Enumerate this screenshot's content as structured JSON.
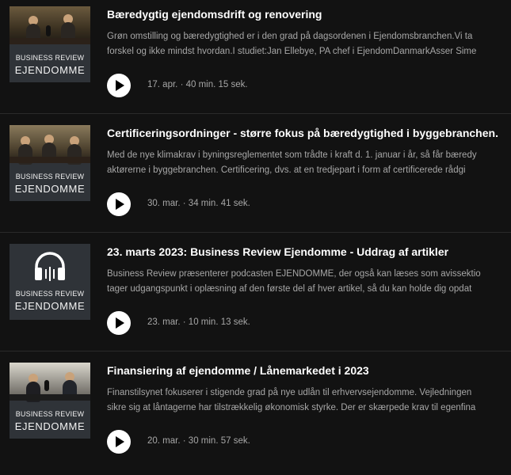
{
  "episodes": [
    {
      "title": "Bæredygtig ejendomsdrift og renovering",
      "desc_line1": "Grøn omstilling og bæredygtighed er i den grad på dagsordenen i Ejendomsbranchen.Vi ta",
      "desc_line2": "forskel og ikke mindst hvordan.I studiet:Jan Ellebye, PA chef i EjendomDanmarkAsser Sime",
      "date": "17. apr.",
      "duration": "40 min. 15 sek.",
      "brand_top": "BUSINESS REVIEW",
      "brand_bottom": "EJENDOMME"
    },
    {
      "title": "Certificeringsordninger - større fokus på bæredygtighed i byggebranchen.",
      "desc_line1": "Med de nye klimakrav i byningsreglementet som trådte i kraft d. 1. januar i år, så får bæredy",
      "desc_line2": "aktørerne i byggebranchen. Certificering, dvs. at en tredjepart i form af certificerede rådgi",
      "date": "30. mar.",
      "duration": "34 min. 41 sek.",
      "brand_top": "BUSINESS REVIEW",
      "brand_bottom": "EJENDOMME"
    },
    {
      "title": "23. marts 2023: Business Review Ejendomme - Uddrag af artikler",
      "desc_line1": "Business Review præsenterer podcasten EJENDOMME, der også kan læses som avissektio",
      "desc_line2": "tager udgangspunkt i oplæsning af den første del af hver artikel, så du kan holde dig opdat",
      "date": "23. mar.",
      "duration": "10 min. 13 sek.",
      "brand_top": "BUSINESS REVIEW",
      "brand_bottom": "EJENDOMME"
    },
    {
      "title": "Finansiering af ejendomme / Lånemarkedet i 2023",
      "desc_line1": "Finanstilsynet fokuserer i stigende grad på nye udlån til erhvervsejendomme. Vejledningen",
      "desc_line2": "sikre sig at låntagerne har tilstrækkelig økonomisk styrke. Der er skærpede krav til egenfina",
      "date": "20. mar.",
      "duration": "30 min. 57 sek.",
      "brand_top": "BUSINESS REVIEW",
      "brand_bottom": "EJENDOMME"
    }
  ],
  "meta_separator": " · ",
  "icons": {
    "play": "play-icon",
    "headphones": "headphones-icon"
  },
  "colors": {
    "background": "#121212",
    "title": "#ffffff",
    "secondary_text": "#a7a7a7",
    "thumbnail_bg": "#2f3338"
  }
}
